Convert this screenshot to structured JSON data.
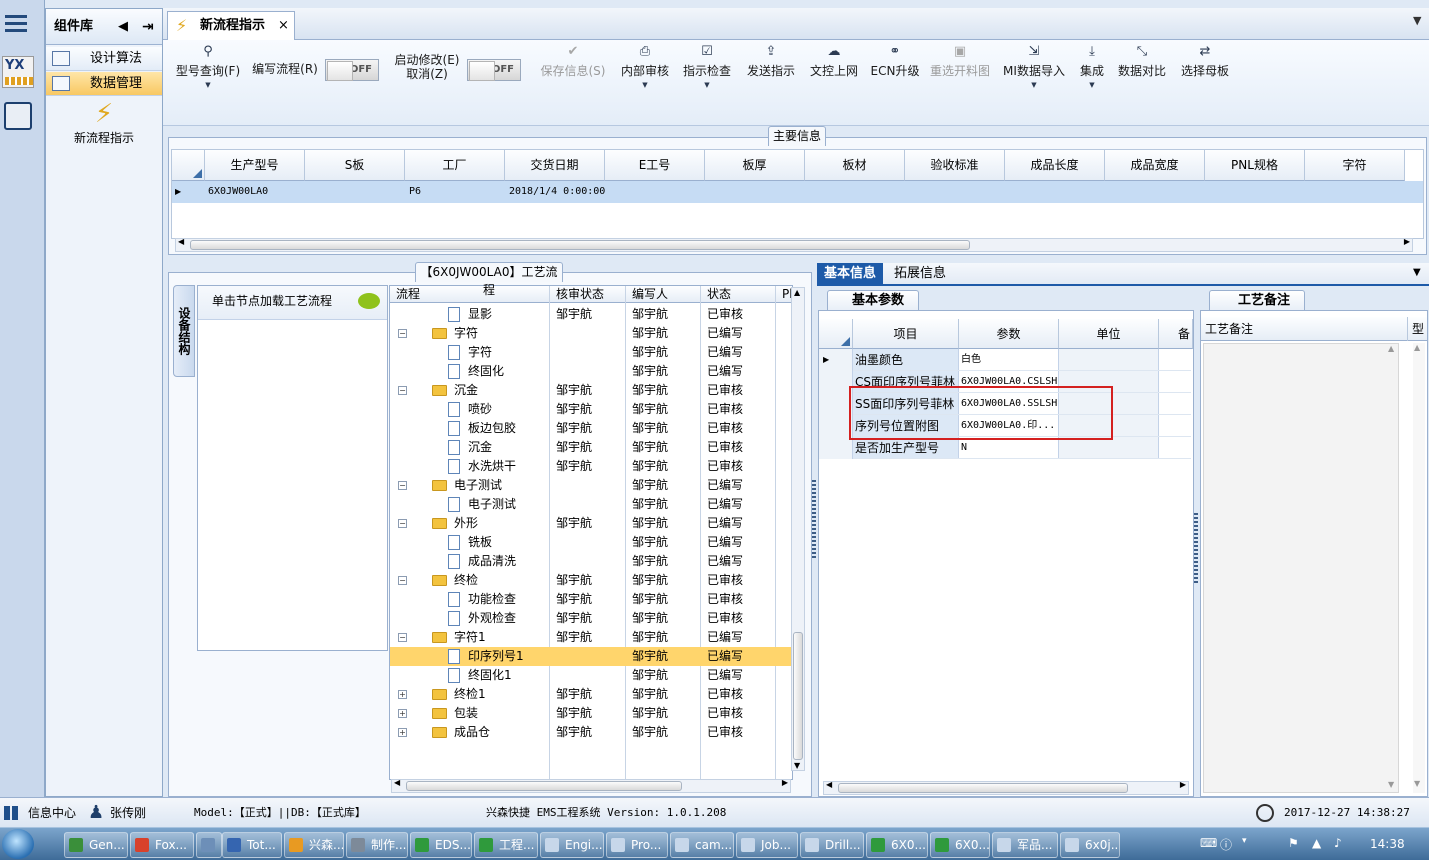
{
  "rail": {
    "icons": [
      "menu-icon",
      "yx-app-icon",
      "tools-app-icon"
    ]
  },
  "component_panel": {
    "title": "组件库",
    "items": [
      {
        "label": "设计算法",
        "selected": false
      },
      {
        "label": "数据管理",
        "selected": true
      }
    ],
    "sub_item": "新流程指示"
  },
  "tabs": [
    {
      "label": "新流程指示",
      "close": "×"
    }
  ],
  "toolbar": {
    "buttons": [
      {
        "label": "型号查询(F)",
        "icon": "search-icon",
        "dropdown": true,
        "disabled": false
      },
      {
        "label": "编写流程(R)",
        "icon": "",
        "dropdown": false,
        "disabled": false
      },
      {
        "label": "启动修改(E)",
        "label2": "取消(Z)",
        "icon": "",
        "dropdown": false,
        "disabled": false
      },
      {
        "label": "保存信息(S)",
        "icon": "check-icon",
        "dropdown": false,
        "disabled": true
      },
      {
        "label": "内部审核",
        "icon": "print-icon",
        "dropdown": true,
        "disabled": false
      },
      {
        "label": "指示检查",
        "icon": "checkbox-icon",
        "dropdown": true,
        "disabled": false
      },
      {
        "label": "发送指示",
        "icon": "upload-icon",
        "dropdown": false,
        "disabled": false
      },
      {
        "label": "文控上网",
        "icon": "cloud-upload-icon",
        "dropdown": false,
        "disabled": false
      },
      {
        "label": "ECN升级",
        "icon": "binoculars-icon",
        "dropdown": false,
        "disabled": false
      },
      {
        "label": "重选开料图",
        "icon": "image-icon",
        "dropdown": false,
        "disabled": true
      },
      {
        "label": "MI数据导入",
        "icon": "import-icon",
        "dropdown": true,
        "disabled": false
      },
      {
        "label": "集成",
        "icon": "download-icon",
        "dropdown": true,
        "disabled": false
      },
      {
        "label": "数据对比",
        "icon": "compress-icon",
        "dropdown": false,
        "disabled": false
      },
      {
        "label": "选择母板",
        "icon": "shuffle-icon",
        "dropdown": false,
        "disabled": false
      }
    ],
    "toggles": [
      "OFF",
      "OFF"
    ]
  },
  "main_info": {
    "title": "主要信息",
    "columns": [
      "生产型号",
      "S板",
      "工厂",
      "交货日期",
      "E工号",
      "板厚",
      "板材",
      "验收标准",
      "成品长度",
      "成品宽度",
      "PNL规格",
      "字符"
    ],
    "rows": [
      [
        "6X0JW00LA0",
        "",
        "P6",
        "2018/1/4 0:00:00",
        "",
        "",
        "",
        "",
        "",
        "",
        "",
        ""
      ]
    ]
  },
  "flow": {
    "title": "【6X0JW00LA0】工艺流程",
    "side_tab": "设备结构",
    "hint": "单击节点加载工艺流程",
    "columns": [
      "流程",
      "核审状态",
      "编写人",
      "状态",
      "Pl"
    ],
    "rows": [
      {
        "name": "显影",
        "level": 2,
        "type": "doc",
        "audit": "邹宇航",
        "writer": "邹宇航",
        "status": "已审核",
        "expander": "",
        "hl": false
      },
      {
        "name": "字符",
        "level": 1,
        "type": "folder",
        "audit": "",
        "writer": "邹宇航",
        "status": "已编写",
        "expander": "−",
        "hl": false
      },
      {
        "name": "字符",
        "level": 2,
        "type": "doc",
        "audit": "",
        "writer": "邹宇航",
        "status": "已编写",
        "expander": "",
        "hl": false
      },
      {
        "name": "终固化",
        "level": 2,
        "type": "doc",
        "audit": "",
        "writer": "邹宇航",
        "status": "已编写",
        "expander": "",
        "hl": false
      },
      {
        "name": "沉金",
        "level": 1,
        "type": "folder",
        "audit": "邹宇航",
        "writer": "邹宇航",
        "status": "已审核",
        "expander": "−",
        "hl": false
      },
      {
        "name": "喷砂",
        "level": 2,
        "type": "doc",
        "audit": "邹宇航",
        "writer": "邹宇航",
        "status": "已审核",
        "expander": "",
        "hl": false
      },
      {
        "name": "板边包胶",
        "level": 2,
        "type": "doc",
        "audit": "邹宇航",
        "writer": "邹宇航",
        "status": "已审核",
        "expander": "",
        "hl": false
      },
      {
        "name": "沉金",
        "level": 2,
        "type": "doc",
        "audit": "邹宇航",
        "writer": "邹宇航",
        "status": "已审核",
        "expander": "",
        "hl": false
      },
      {
        "name": "水洗烘干",
        "level": 2,
        "type": "doc",
        "audit": "邹宇航",
        "writer": "邹宇航",
        "status": "已审核",
        "expander": "",
        "hl": false
      },
      {
        "name": "电子测试",
        "level": 1,
        "type": "folder",
        "audit": "",
        "writer": "邹宇航",
        "status": "已编写",
        "expander": "−",
        "hl": false
      },
      {
        "name": "电子测试",
        "level": 2,
        "type": "doc",
        "audit": "",
        "writer": "邹宇航",
        "status": "已编写",
        "expander": "",
        "hl": false
      },
      {
        "name": "外形",
        "level": 1,
        "type": "folder",
        "audit": "邹宇航",
        "writer": "邹宇航",
        "status": "已编写",
        "expander": "−",
        "hl": false
      },
      {
        "name": "铣板",
        "level": 2,
        "type": "doc",
        "audit": "",
        "writer": "邹宇航",
        "status": "已编写",
        "expander": "",
        "hl": false
      },
      {
        "name": "成品清洗",
        "level": 2,
        "type": "doc",
        "audit": "",
        "writer": "邹宇航",
        "status": "已编写",
        "expander": "",
        "hl": false
      },
      {
        "name": "终检",
        "level": 1,
        "type": "folder",
        "audit": "邹宇航",
        "writer": "邹宇航",
        "status": "已审核",
        "expander": "−",
        "hl": false
      },
      {
        "name": "功能检查",
        "level": 2,
        "type": "doc",
        "audit": "邹宇航",
        "writer": "邹宇航",
        "status": "已审核",
        "expander": "",
        "hl": false
      },
      {
        "name": "外观检查",
        "level": 2,
        "type": "doc",
        "audit": "邹宇航",
        "writer": "邹宇航",
        "status": "已审核",
        "expander": "",
        "hl": false
      },
      {
        "name": "字符1",
        "level": 1,
        "type": "folder",
        "audit": "邹宇航",
        "writer": "邹宇航",
        "status": "已编写",
        "expander": "−",
        "hl": false
      },
      {
        "name": "印序列号1",
        "level": 2,
        "type": "doc",
        "audit": "",
        "writer": "邹宇航",
        "status": "已编写",
        "expander": "",
        "hl": true
      },
      {
        "name": "终固化1",
        "level": 2,
        "type": "doc",
        "audit": "",
        "writer": "邹宇航",
        "status": "已编写",
        "expander": "",
        "hl": false
      },
      {
        "name": "终检1",
        "level": 1,
        "type": "folder",
        "audit": "邹宇航",
        "writer": "邹宇航",
        "status": "已审核",
        "expander": "+",
        "hl": false
      },
      {
        "name": "包装",
        "level": 1,
        "type": "folder",
        "audit": "邹宇航",
        "writer": "邹宇航",
        "status": "已审核",
        "expander": "+",
        "hl": false
      },
      {
        "name": "成品仓",
        "level": 1,
        "type": "folder",
        "audit": "邹宇航",
        "writer": "邹宇航",
        "status": "已审核",
        "expander": "+",
        "hl": false
      }
    ]
  },
  "right_panel": {
    "tabs": [
      "基本信息",
      "拓展信息"
    ],
    "params": {
      "title": "基本参数",
      "columns": [
        "项目",
        "参数",
        "单位",
        "备"
      ],
      "rows": [
        {
          "item": "油墨颜色",
          "value": "白色"
        },
        {
          "item": "CS面印序列号菲林",
          "value": "6X0JW00LA0.CSLSH"
        },
        {
          "item": "SS面印序列号菲林",
          "value": "6X0JW00LA0.SSLSH"
        },
        {
          "item": "序列号位置附图",
          "value": "6X0JW00LA0.印..."
        },
        {
          "item": "是否加生产型号",
          "value": "N"
        }
      ]
    },
    "notes": {
      "title": "工艺备注",
      "columns": [
        "工艺备注",
        "型"
      ]
    }
  },
  "status": {
    "info_center": "信息中心",
    "user": "张传刚",
    "model": "Model:【正式】||DB:【正式库】",
    "system": "兴森快捷 EMS工程系统 Version: 1.0.1.208",
    "datetime": "2017-12-27 14:38:27"
  },
  "taskbar": {
    "items": [
      {
        "label": "Gen...",
        "color": "#3a8f3a"
      },
      {
        "label": "Fox...",
        "color": "#d8412b"
      },
      {
        "label": "",
        "color": "#6d8fb8"
      },
      {
        "label": "Tot...",
        "color": "#3565b0"
      },
      {
        "label": "兴森...",
        "color": "#e89a22"
      },
      {
        "label": "制作...",
        "color": "#7d8a99"
      },
      {
        "label": "EDS...",
        "color": "#2f9a3c"
      },
      {
        "label": "工程...",
        "color": "#2f9a3c"
      },
      {
        "label": "Engi...",
        "color": "#c7d7ea"
      },
      {
        "label": "Pro...",
        "color": "#c7d7ea"
      },
      {
        "label": "cam...",
        "color": "#c7d7ea"
      },
      {
        "label": "Job...",
        "color": "#c7d7ea"
      },
      {
        "label": "Drill...",
        "color": "#c7d7ea"
      },
      {
        "label": "6X0...",
        "color": "#2f9a3c"
      },
      {
        "label": "6X0...",
        "color": "#2f9a3c"
      },
      {
        "label": "军品...",
        "color": "#c7d7ea"
      },
      {
        "label": "6x0j...",
        "color": "#c7d7ea"
      }
    ],
    "clock": "14:38"
  }
}
